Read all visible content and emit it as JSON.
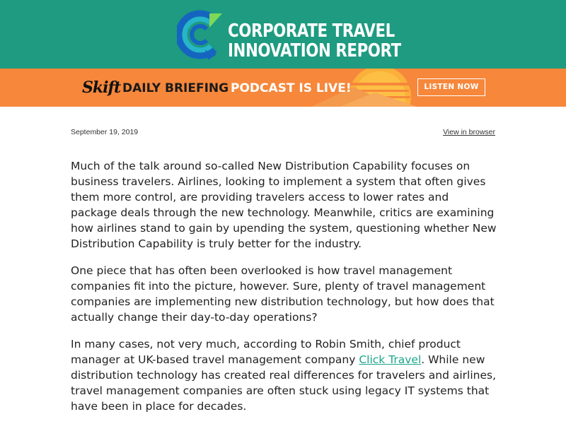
{
  "header": {
    "logo_line1": "CORPORATE TRAVEL",
    "logo_line2": "INNOVATION REPORT",
    "background_color": "#1e9b80",
    "logo_icon": "c-arrow-logo-icon"
  },
  "banner": {
    "brand": "Skift",
    "text_part1": "DAILY BRIEFING",
    "text_part2": "PODCAST IS LIVE!",
    "button_label": "LISTEN NOW",
    "background_color": "#f6873b"
  },
  "meta": {
    "date": "September 19, 2019",
    "view_in_browser": "View in browser"
  },
  "article": {
    "paragraph1": "Much of the talk around so-called New Distribution Capability focuses on business travelers. Airlines, looking to implement a system that often gives them more control, are providing travelers access to lower rates and package deals through the new technology. Meanwhile, critics are examining how airlines stand to gain by upending the system, questioning whether New Distribution Capability is truly better for the industry.",
    "paragraph2": "One piece that has often been overlooked is how travel management companies fit into the picture, however. Sure, plenty of travel management companies are implementing new distribution technology, but how does that actually change their day-to-day operations?",
    "paragraph3_before": "In many cases, not very much, according to Robin Smith, chief product manager at UK-based travel management company ",
    "paragraph3_link": "Click Travel",
    "paragraph3_after": ". While new distribution technology has created real differences for travelers and airlines, travel management companies are often stuck using legacy IT systems that have been in place for decades.",
    "link_color": "#1aa58a"
  }
}
